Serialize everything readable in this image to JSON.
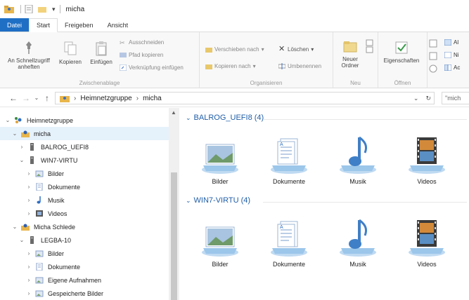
{
  "window": {
    "title": "micha"
  },
  "ribbon_tabs": [
    "Datei",
    "Start",
    "Freigeben",
    "Ansicht"
  ],
  "ribbon": {
    "pin_label": "An Schnellzugriff anheften",
    "copy_label": "Kopieren",
    "paste_label": "Einfügen",
    "cut_label": "Ausschneiden",
    "copy_path_label": "Pfad kopieren",
    "paste_shortcut_label": "Verknüpfung einfügen",
    "clipboard_group": "Zwischenablage",
    "move_to_label": "Verschieben nach",
    "copy_to_label": "Kopieren nach",
    "delete_label": "Löschen",
    "rename_label": "Umbenennen",
    "organize_group": "Organisieren",
    "new_folder_label": "Neuer Ordner",
    "new_group": "Neu",
    "properties_label": "Eigenschaften",
    "open_group": "Öffnen",
    "select_all_label": "Al",
    "select_none_label": "Ni",
    "invert_label": "Ac"
  },
  "address": {
    "crumbs": [
      "Heimnetzgruppe",
      "micha"
    ],
    "search_placeholder": "\"mich"
  },
  "nav_tree": [
    {
      "label": "Heimnetzgruppe",
      "icon": "homegroup-icon",
      "chevron": "v",
      "indent": 0
    },
    {
      "label": "micha",
      "icon": "user-icon",
      "chevron": "v",
      "indent": 1,
      "selected": true
    },
    {
      "label": "BALROG_UEFI8",
      "icon": "computer-icon",
      "chevron": ">",
      "indent": 2
    },
    {
      "label": "WIN7-VIRTU",
      "icon": "computer-icon",
      "chevron": "v",
      "indent": 2
    },
    {
      "label": "Bilder",
      "icon": "pictures-icon",
      "chevron": ">",
      "indent": 3
    },
    {
      "label": "Dokumente",
      "icon": "documents-icon",
      "chevron": ">",
      "indent": 3
    },
    {
      "label": "Musik",
      "icon": "music-icon",
      "chevron": ">",
      "indent": 3
    },
    {
      "label": "Videos",
      "icon": "videos-icon",
      "chevron": ">",
      "indent": 3
    },
    {
      "label": "Micha Schlede",
      "icon": "user-icon",
      "chevron": "v",
      "indent": 1
    },
    {
      "label": "LEGBA-10",
      "icon": "computer-icon",
      "chevron": "v",
      "indent": 2
    },
    {
      "label": "Bilder",
      "icon": "pictures-icon",
      "chevron": ">",
      "indent": 3
    },
    {
      "label": "Dokumente",
      "icon": "documents-icon",
      "chevron": ">",
      "indent": 3
    },
    {
      "label": "Eigene Aufnahmen",
      "icon": "pictures-icon",
      "chevron": ">",
      "indent": 3
    },
    {
      "label": "Gespeicherte Bilder",
      "icon": "pictures-icon",
      "chevron": ">",
      "indent": 3
    }
  ],
  "groups": [
    {
      "title": "BALROG_UEFI8 (4)",
      "items": [
        "Bilder",
        "Dokumente",
        "Musik",
        "Videos"
      ]
    },
    {
      "title": "WIN7-VIRTU (4)",
      "items": [
        "Bilder",
        "Dokumente",
        "Musik",
        "Videos"
      ]
    }
  ],
  "colors": {
    "accent": "#1f6fc5",
    "group_header": "#1f5ea8",
    "selection": "#e5f1fb"
  }
}
